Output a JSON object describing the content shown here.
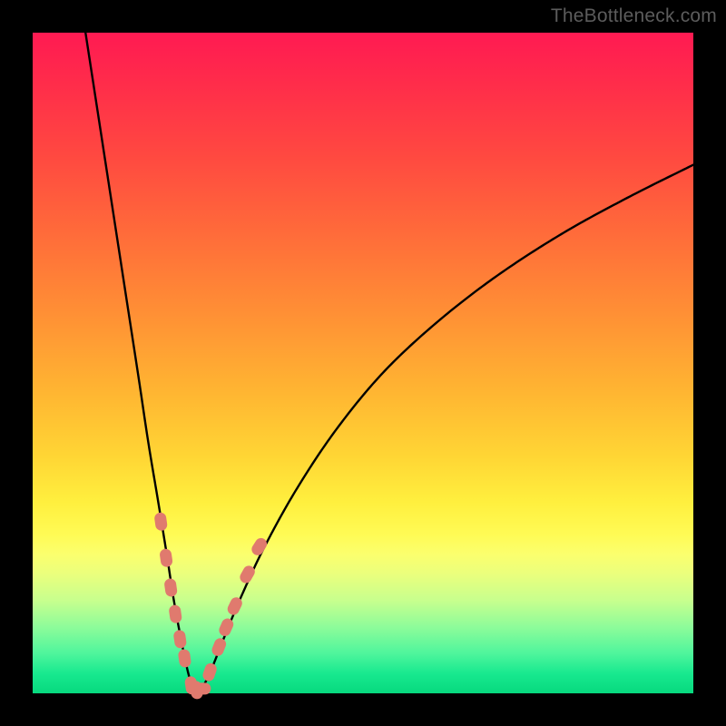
{
  "watermark": "TheBottleneck.com",
  "colors": {
    "frame": "#000000",
    "curve": "#000000",
    "marker_fill": "#e07a6e",
    "marker_stroke": "#d86a5e",
    "gradient_stops": [
      "#ff1a52",
      "#ff2d4a",
      "#ff4741",
      "#ff6a3a",
      "#ff8e35",
      "#ffb432",
      "#ffd534",
      "#ffef3e",
      "#fffb55",
      "#fbff6e",
      "#eaff7d",
      "#c7ff8e",
      "#8dfc9a",
      "#4ef59c",
      "#18e98f",
      "#07d97e"
    ]
  },
  "chart_data": {
    "type": "line",
    "title": "",
    "xlabel": "",
    "ylabel": "",
    "xlim": [
      0,
      100
    ],
    "ylim": [
      0,
      100
    ],
    "grid": false,
    "note": "V-shaped bottleneck curve. x roughly = component balance position, y roughly = bottleneck % (0 at valley floor). Points highlighted with pink capsule markers cluster near the valley walls at low y.",
    "series": [
      {
        "name": "left-branch",
        "x": [
          8,
          10,
          12,
          14,
          16,
          17.5,
          19,
          20.3,
          21.3,
          22.2,
          23,
          23.7,
          24.4
        ],
        "y": [
          100,
          87,
          74,
          61,
          48,
          38,
          29,
          21,
          14.5,
          9.5,
          5.5,
          2.5,
          0.8
        ]
      },
      {
        "name": "right-branch",
        "x": [
          25.7,
          27,
          29,
          31.5,
          35,
          40,
          46,
          53,
          61,
          70,
          80,
          90,
          100
        ],
        "y": [
          0.8,
          3.5,
          8.5,
          14.5,
          22,
          31,
          40,
          48.5,
          56,
          63,
          69.5,
          75,
          80
        ]
      }
    ],
    "markers": [
      {
        "cluster": "left-wall",
        "points": [
          {
            "x": 19.4,
            "y": 26
          },
          {
            "x": 20.2,
            "y": 20.5
          },
          {
            "x": 20.9,
            "y": 16
          },
          {
            "x": 21.6,
            "y": 12
          },
          {
            "x": 22.3,
            "y": 8.2
          },
          {
            "x": 23.0,
            "y": 5.3
          }
        ]
      },
      {
        "cluster": "valley-floor",
        "points": [
          {
            "x": 24.0,
            "y": 1.2
          },
          {
            "x": 24.8,
            "y": 0.5
          },
          {
            "x": 25.6,
            "y": 0.7
          }
        ]
      },
      {
        "cluster": "right-wall",
        "points": [
          {
            "x": 26.8,
            "y": 3.2
          },
          {
            "x": 28.2,
            "y": 7.0
          },
          {
            "x": 29.3,
            "y": 10.0
          },
          {
            "x": 30.6,
            "y": 13.2
          },
          {
            "x": 32.5,
            "y": 18.0
          },
          {
            "x": 34.3,
            "y": 22.2
          }
        ]
      }
    ]
  }
}
